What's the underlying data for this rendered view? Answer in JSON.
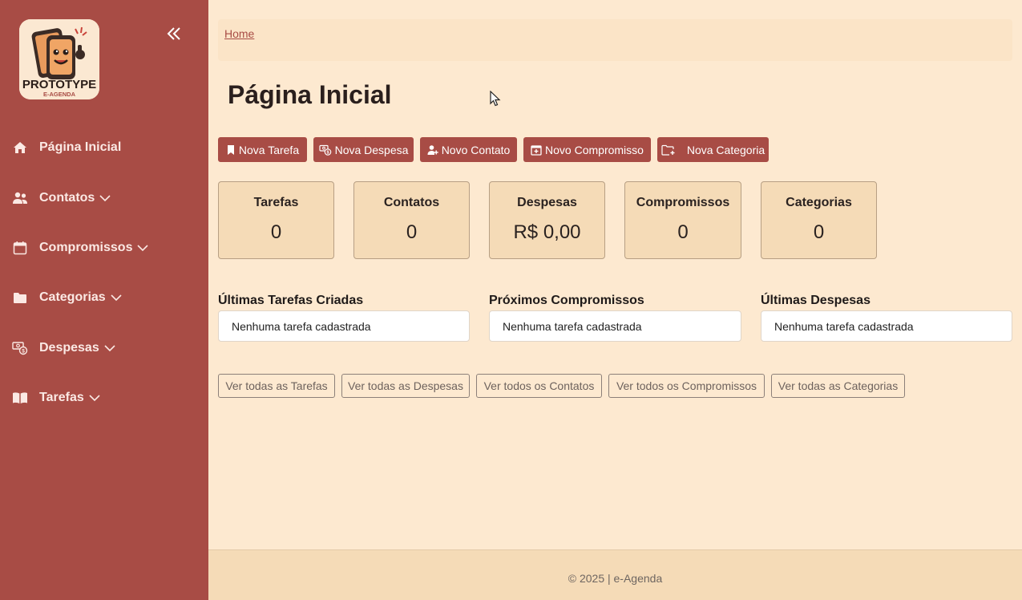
{
  "sidebar": {
    "logo": {
      "text_main": "PROTOTYPE",
      "text_sub": "E-AGENDA"
    },
    "items": [
      {
        "label": "Página Inicial",
        "icon": "home-icon",
        "has_chevron": false
      },
      {
        "label": "Contatos",
        "icon": "users-icon",
        "has_chevron": true
      },
      {
        "label": "Compromissos",
        "icon": "calendar-icon",
        "has_chevron": true
      },
      {
        "label": "Categorias",
        "icon": "folder-icon",
        "has_chevron": true
      },
      {
        "label": "Despesas",
        "icon": "cash-coin-icon",
        "has_chevron": true
      },
      {
        "label": "Tarefas",
        "icon": "book-icon",
        "has_chevron": true
      }
    ]
  },
  "breadcrumb": {
    "home": "Home"
  },
  "page_title": "Página Inicial",
  "actions": [
    {
      "label": "Nova Tarefa",
      "icon": "bookmark-icon"
    },
    {
      "label": "Nova Despesa",
      "icon": "cash-coin-icon"
    },
    {
      "label": "Novo Contato",
      "icon": "person-plus-icon"
    },
    {
      "label": "Novo Compromisso",
      "icon": "calendar-plus-icon"
    },
    {
      "label": "Nova Categoria",
      "icon": "folder-plus-icon"
    }
  ],
  "stats": [
    {
      "title": "Tarefas",
      "value": "0"
    },
    {
      "title": "Contatos",
      "value": "0"
    },
    {
      "title": "Despesas",
      "value": "R$ 0,00"
    },
    {
      "title": "Compromissos",
      "value": "0"
    },
    {
      "title": "Categorias",
      "value": "0"
    }
  ],
  "sections": [
    {
      "title": "Últimas Tarefas Criadas",
      "empty_text": "Nenhuma tarefa cadastrada"
    },
    {
      "title": "Próximos Compromissos",
      "empty_text": "Nenhuma tarefa cadastrada"
    },
    {
      "title": "Últimas Despesas",
      "empty_text": "Nenhuma tarefa cadastrada"
    }
  ],
  "links": [
    {
      "label": "Ver todas as Tarefas"
    },
    {
      "label": "Ver todas as Despesas"
    },
    {
      "label": "Ver todos os Contatos"
    },
    {
      "label": "Ver todos os Compromissos"
    },
    {
      "label": "Ver todas as Categorias"
    }
  ],
  "footer": {
    "text": "© 2025 | e-Agenda"
  },
  "colors": {
    "sidebar": "#a84c45",
    "background": "#fde9d0",
    "card": "#f5dbb7",
    "accent": "#a84c45"
  }
}
